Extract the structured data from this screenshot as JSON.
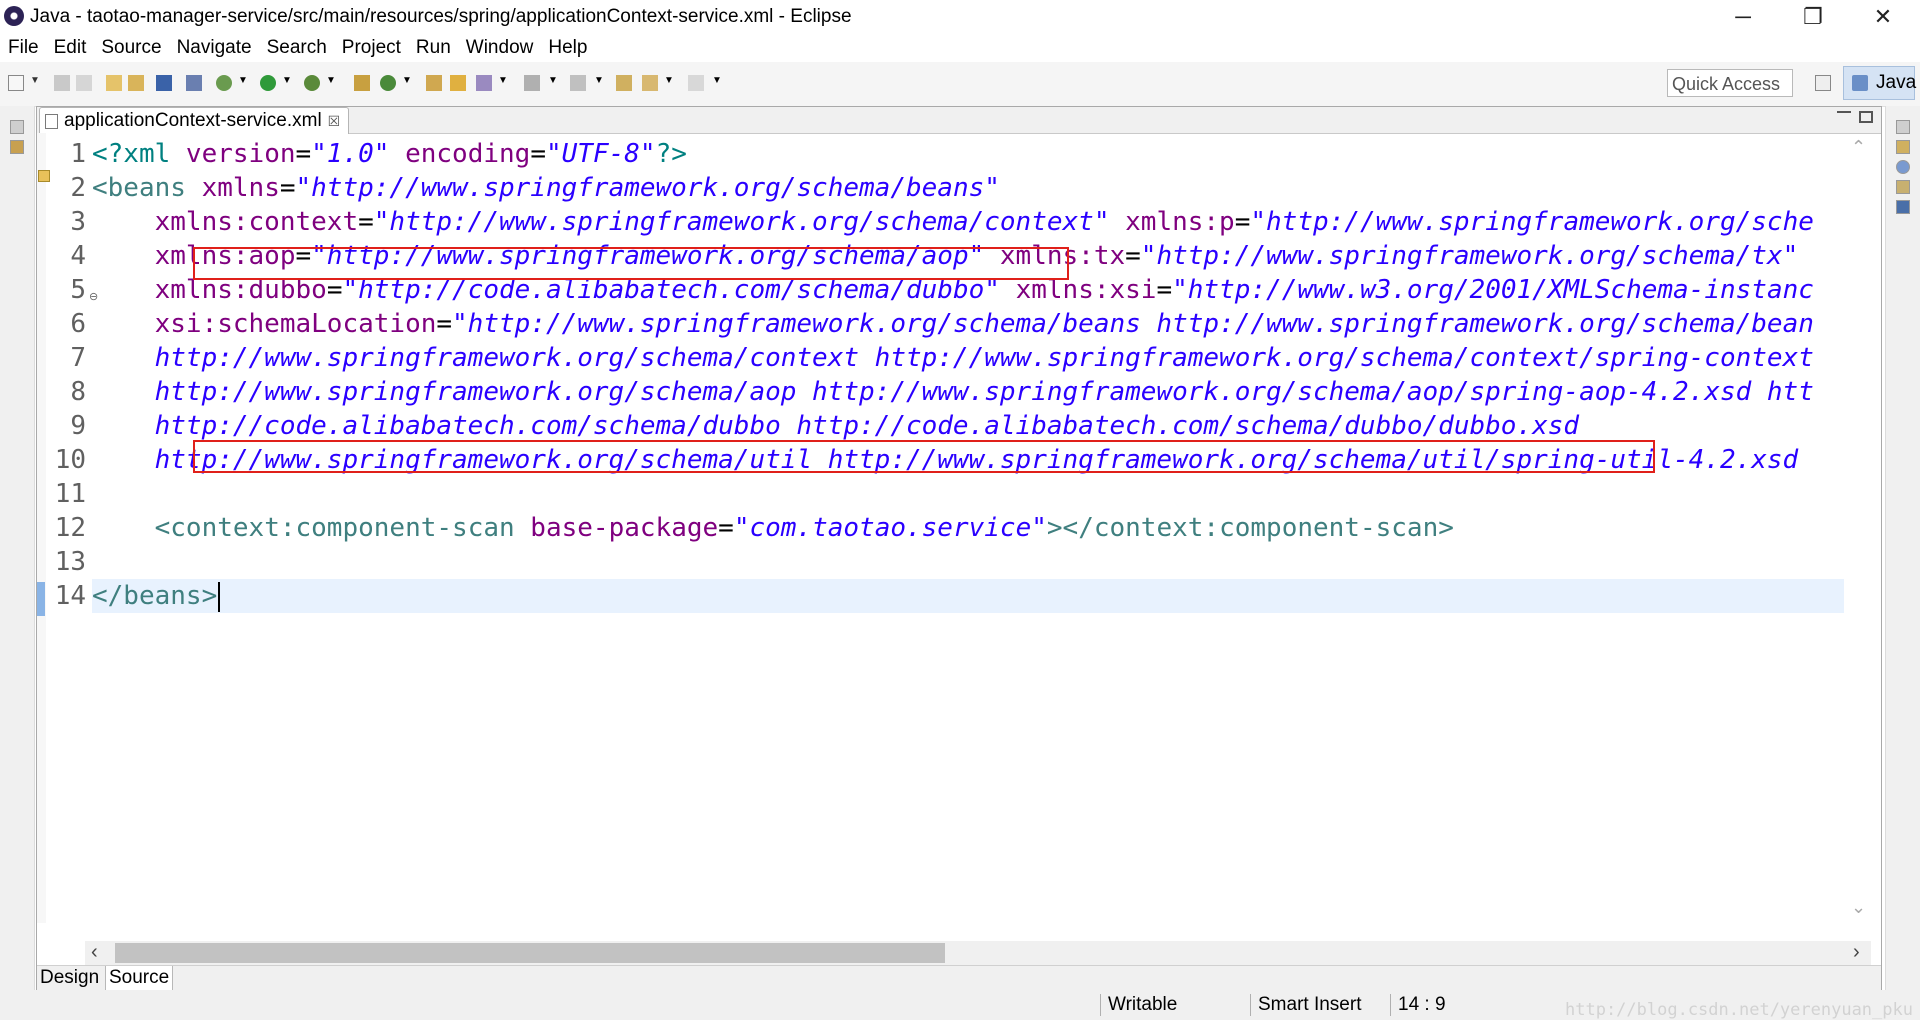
{
  "window": {
    "title": "Java - taotao-manager-service/src/main/resources/spring/applicationContext-service.xml - Eclipse",
    "minimize": "─",
    "restore": "❐",
    "close": "✕"
  },
  "menu": [
    "File",
    "Edit",
    "Source",
    "Navigate",
    "Search",
    "Project",
    "Run",
    "Window",
    "Help"
  ],
  "toolbar": {
    "quick_access_placeholder": "Quick Access",
    "perspective_label": "Java"
  },
  "editor": {
    "tab_label": "applicationContext-service.xml",
    "tab_close": "☒",
    "line_numbers": [
      "1",
      "2",
      "3",
      "4",
      "5",
      "6",
      "7",
      "8",
      "9",
      "10",
      "11",
      "12",
      "13",
      "14"
    ],
    "fold_marker": "⊖",
    "current_line": 14,
    "code": {
      "l1": {
        "decl": "<?xml ",
        "k1": "version",
        "eq1": "=",
        "v1": "\"1.0\"",
        "k2": " encoding",
        "eq2": "=",
        "v2": "\"UTF-8\"",
        "end": "?>"
      },
      "l2": {
        "tag": "<beans",
        "k": " xmlns",
        "eq": "=",
        "v": "\"http://www.springframework.org/schema/beans\""
      },
      "l3": {
        "k1": "    xmlns:context",
        "eq1": "=",
        "v1": "\"http://www.springframework.org/schema/context\"",
        "k2": " xmlns:p",
        "eq2": "=",
        "v2": "\"http://www.springframework.org/sche"
      },
      "l4": {
        "k1": "    xmlns:aop",
        "eq1": "=",
        "v1": "\"http://www.springframework.org/schema/aop\"",
        "k2": " xmlns:tx",
        "eq2": "=",
        "v2": "\"http://www.springframework.org/schema/tx\""
      },
      "l5": {
        "k1": "    xmlns:dubbo",
        "eq1": "=",
        "v1": "\"http://code.alibabatech.com/schema/dubbo\"",
        "k2": " xmlns:xsi",
        "eq2": "=",
        "v2": "\"http://www.w3.org/2001/XMLSchema-instanc"
      },
      "l6": {
        "k1": "    xsi:schemaLocation",
        "eq1": "=",
        "v1": "\"http://www.springframework.org/schema/beans http://www.springframework.org/schema/bean"
      },
      "l7": {
        "v": "    http://www.springframework.org/schema/context http://www.springframework.org/schema/context/spring-context"
      },
      "l8": {
        "v": "    http://www.springframework.org/schema/aop http://www.springframework.org/schema/aop/spring-aop-4.2.xsd htt"
      },
      "l9": {
        "v": "    http://code.alibabatech.com/schema/dubbo http://code.alibabatech.com/schema/dubbo/dubbo.xsd"
      },
      "l10": {
        "v": "    http://www.springframework.org/schema/util http://www.springframework.org/schema/util/spring-util-4.2.xsd"
      },
      "l11": "",
      "l12": {
        "indent": "    ",
        "tag1": "<context:component-scan",
        "k": " base-package",
        "eq": "=",
        "v": "\"com.taotao.service\"",
        "tag2": "></context:component-scan>"
      },
      "l13": "",
      "l14": {
        "tag": "</beans>"
      }
    },
    "bottom_tabs": [
      "Design",
      "Source"
    ]
  },
  "status": {
    "writable": "Writable",
    "insert_mode": "Smart Insert",
    "position": "14 : 9"
  },
  "watermark": "http://blog.csdn.net/yerenyuan_pku",
  "colors": {
    "tag": "#3f7f7f",
    "attribute": "#7f007f",
    "value": "#2a00ff",
    "highlight_box": "#e0201a",
    "current_line": "#e8f2fe"
  }
}
